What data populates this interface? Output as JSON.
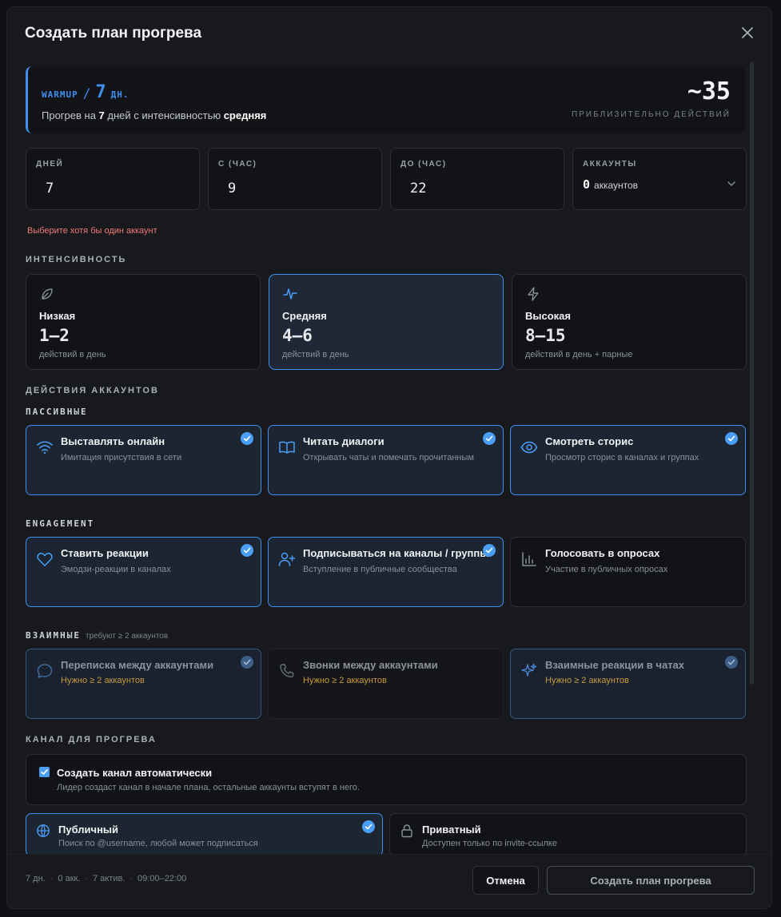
{
  "modal": {
    "title": "Создать план прогрева"
  },
  "summary": {
    "tag": "WARMUP",
    "slash": "/",
    "days": "7",
    "days_unit": "ДН.",
    "desc_prefix": "Прогрев на ",
    "desc_days": "7",
    "desc_mid": " дней с интенсивностью ",
    "desc_level": "средняя",
    "approx_value": "~35",
    "approx_label": "ПРИБЛИЗИТЕЛЬНО ДЕЙСТВИЙ"
  },
  "fields": {
    "days": {
      "label": "ДНЕЙ",
      "value": "7"
    },
    "from": {
      "label": "С (ЧАС)",
      "value": "9"
    },
    "to": {
      "label": "ДО (ЧАС)",
      "value": "22"
    },
    "accounts": {
      "label": "АККАУНТЫ",
      "count": "0",
      "unit": "аккаунтов"
    }
  },
  "error": "Выберите хотя бы один аккаунт",
  "intensity": {
    "label": "ИНТЕНСИВНОСТЬ",
    "options": [
      {
        "name": "Низкая",
        "range": "1–2",
        "sub": "действий в день",
        "icon": "leaf-icon",
        "active": false
      },
      {
        "name": "Средняя",
        "range": "4–6",
        "sub": "действий в день",
        "icon": "pulse-icon",
        "active": true
      },
      {
        "name": "Высокая",
        "range": "8–15",
        "sub": "действий в день + парные",
        "icon": "bolt-icon",
        "active": false
      }
    ]
  },
  "actions": {
    "label": "ДЕЙСТВИЯ АККАУНТОВ",
    "passive": {
      "label": "ПАССИВНЫЕ",
      "items": [
        {
          "title": "Выставлять онлайн",
          "desc": "Имитация присутствия в сети",
          "icon": "wifi-icon",
          "checked": true
        },
        {
          "title": "Читать диалоги",
          "desc": "Открывать чаты и помечать прочитанным",
          "icon": "book-icon",
          "checked": true
        },
        {
          "title": "Смотреть сторис",
          "desc": "Просмотр сторис в каналах и группах",
          "icon": "eye-icon",
          "checked": true
        }
      ]
    },
    "engagement": {
      "label": "ENGAGEMENT",
      "items": [
        {
          "title": "Ставить реакции",
          "desc": "Эмодзи-реакции в каналах",
          "icon": "heart-icon",
          "checked": true
        },
        {
          "title": "Подписываться на каналы / группы",
          "desc": "Вступление в публичные сообщества",
          "icon": "user-plus-icon",
          "checked": true
        },
        {
          "title": "Голосовать в опросах",
          "desc": "Участие в публичных опросах",
          "icon": "bar-chart-icon",
          "checked": false
        }
      ]
    },
    "mutual": {
      "label": "ВЗАИМНЫЕ",
      "hint": "требуют ≥ 2 аккаунтов",
      "items": [
        {
          "title": "Переписка между аккаунтами",
          "note": "Нужно ≥ 2 аккаунтов",
          "icon": "chat-bubble-icon",
          "checked": true
        },
        {
          "title": "Звонки между аккаунтами",
          "note": "Нужно ≥ 2 аккаунтов",
          "icon": "phone-icon",
          "checked": false
        },
        {
          "title": "Взаимные реакции в чатах",
          "note": "Нужно ≥ 2 аккаунтов",
          "icon": "sparkles-icon",
          "checked": true
        }
      ]
    }
  },
  "channel": {
    "label": "КАНАЛ ДЛЯ ПРОГРЕВА",
    "auto": {
      "title": "Создать канал автоматически",
      "desc": "Лидер создаст канал в начале плана, остальные аккаунты вступят в него.",
      "checked": true
    },
    "public": {
      "title": "Публичный",
      "desc": "Поиск по @username, любой может подписаться",
      "icon": "globe-icon",
      "checked": true
    },
    "private": {
      "title": "Приватный",
      "desc": "Доступен только по invite-ссылке",
      "icon": "lock-icon",
      "checked": false
    }
  },
  "footer": {
    "stats": [
      "7 дн.",
      "0 акк.",
      "7 актив.",
      "09:00–22:00"
    ],
    "separator": "·",
    "cancel": "Отмена",
    "create": "Создать план прогрева"
  },
  "colors": {
    "accent": "#3f8ff0",
    "error": "#f07a7a",
    "warning": "#c99a3c",
    "surface": "#17191d"
  }
}
